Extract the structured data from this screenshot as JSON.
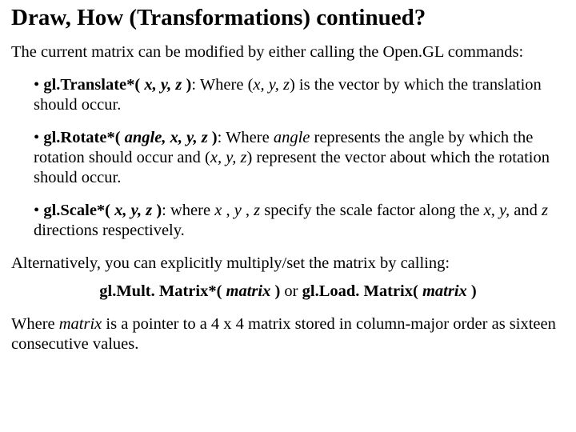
{
  "title": "Draw, How (Transformations) continued?",
  "intro": "The current matrix can be modified by either calling the Open.GL commands:",
  "b1": {
    "bullet": "• ",
    "fn": "gl.Translate*( ",
    "args": "x, y, z",
    "close": " )",
    "after1": ": Where (",
    "vec": "x, y, z",
    "after2": ") is the vector by which the translation should occur."
  },
  "b2": {
    "bullet": "• ",
    "fn": "gl.Rotate*( ",
    "args": "angle, x, y, z",
    "close": " )",
    "after1": ": Where ",
    "ang": "angle",
    "after2": " represents the angle by which the rotation should occur and (",
    "vec": "x, y, z",
    "after3": ") represent the vector about which the rotation should occur."
  },
  "b3": {
    "bullet": "• ",
    "fn": "gl.Scale*( ",
    "args": "x, y, z",
    "close": " )",
    "after1": ": where ",
    "x": "x",
    "mid1": " , ",
    "y": "y",
    "mid2": " , ",
    "z": "z",
    "after2": "  specify the scale factor along the ",
    "xyz": "x, y,",
    "mid3": " and ",
    "zz": "z",
    "after3": " directions respectively."
  },
  "alt": "Alternatively, you can explicitly multiply/set the matrix by calling:",
  "sig": {
    "fn1": "gl.Mult. Matrix*( ",
    "m1": "matrix",
    "close1": " )",
    "or": " or ",
    "fn2": "gl.Load. Matrix( ",
    "m2": "matrix",
    "close2": " )"
  },
  "where": {
    "pre": "Where ",
    "m": "matrix",
    "post": " is a pointer to a 4 x 4 matrix stored in column-major order as sixteen consecutive values."
  }
}
